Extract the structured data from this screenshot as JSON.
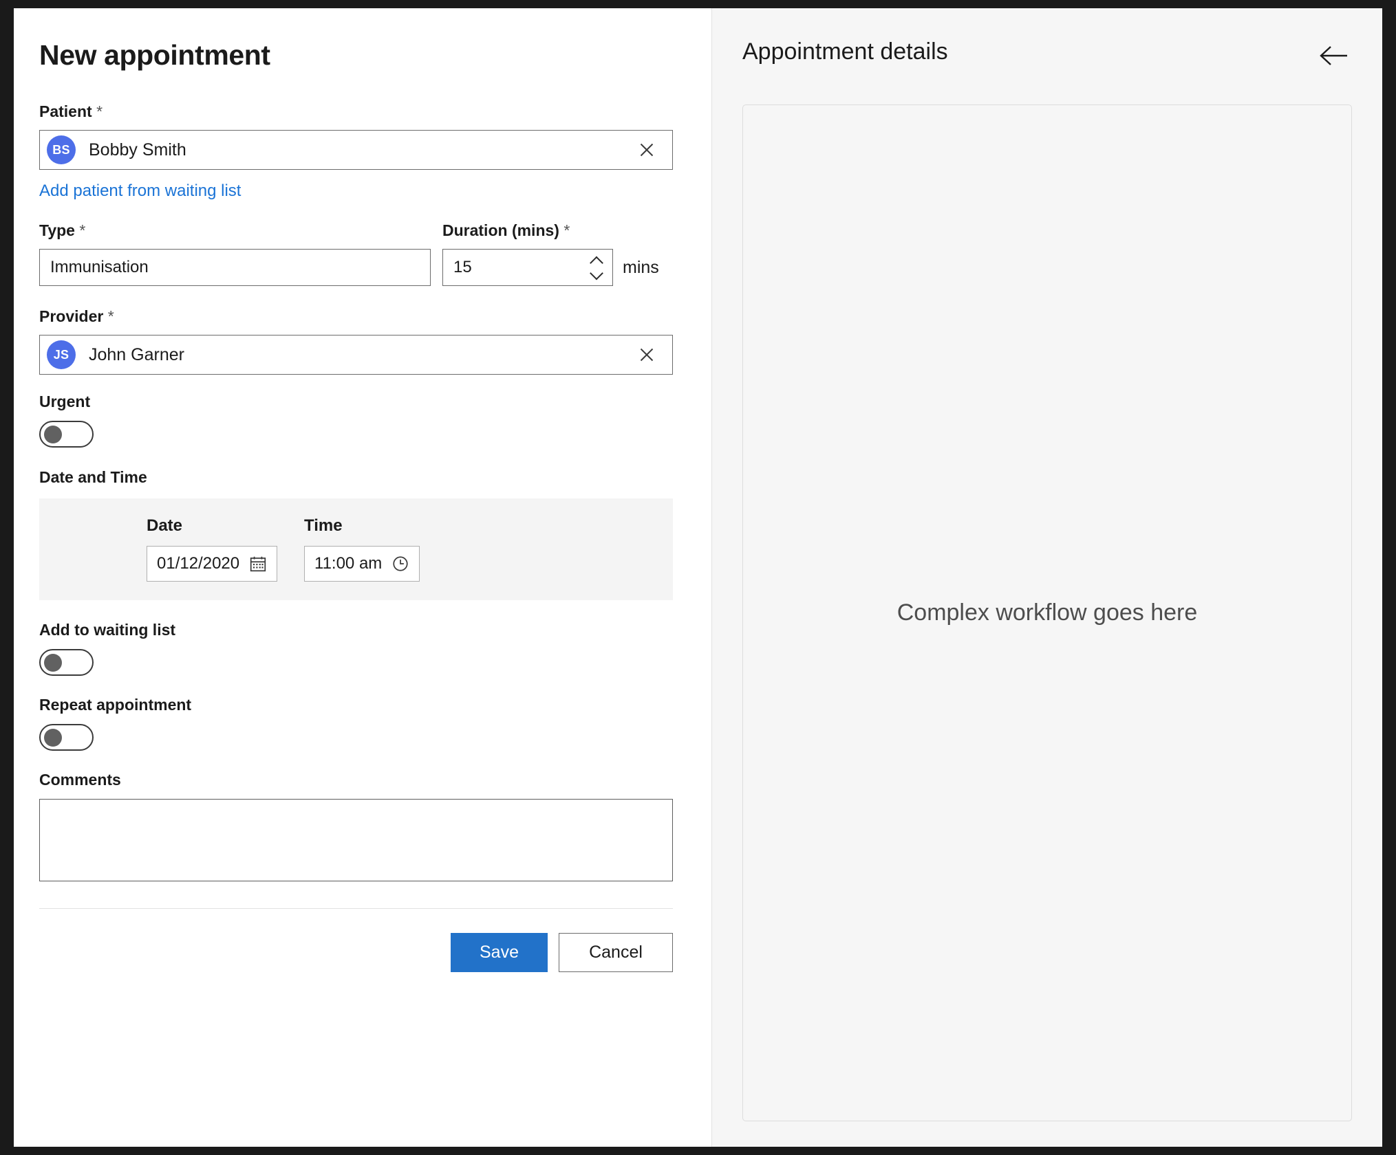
{
  "window": {
    "left_panel": {
      "title": "New appointment",
      "patient": {
        "label": "Patient",
        "required_marker": "*",
        "avatar_initials": "BS",
        "value": "Bobby Smith",
        "clear_icon": "close-icon",
        "waiting_list_link": "Add patient from waiting list"
      },
      "type": {
        "label": "Type",
        "required_marker": "*",
        "value": "Immunisation"
      },
      "duration": {
        "label": "Duration (mins)",
        "required_marker": "*",
        "value": "15",
        "suffix": "mins",
        "increment_icon": "chevron-up-icon",
        "decrement_icon": "chevron-down-icon"
      },
      "provider": {
        "label": "Provider",
        "required_marker": "*",
        "avatar_initials": "JS",
        "value": "John Garner",
        "clear_icon": "close-icon"
      },
      "urgent": {
        "label": "Urgent",
        "state": "off"
      },
      "date_and_time": {
        "section_label": "Date and Time",
        "date_label": "Date",
        "date_value": "01/12/2020",
        "date_icon": "calendar-icon",
        "time_label": "Time",
        "time_value": "11:00 am",
        "time_icon": "clock-icon"
      },
      "add_to_waiting_list": {
        "label": "Add to waiting list",
        "state": "off"
      },
      "repeat_appointment": {
        "label": "Repeat appointment",
        "state": "off"
      },
      "comments": {
        "label": "Comments",
        "value": "",
        "placeholder": ""
      },
      "actions": {
        "save_label": "Save",
        "cancel_label": "Cancel"
      }
    },
    "right_panel": {
      "title": "Appointment details",
      "back_icon": "arrow-left-icon",
      "placeholder": "Complex workflow goes here"
    }
  },
  "colors": {
    "primary_button": "#2272c9",
    "link": "#1a73d6",
    "avatar": "#4d6ee8",
    "panel_background": "#f6f6f6",
    "section_background": "#f4f4f4"
  }
}
